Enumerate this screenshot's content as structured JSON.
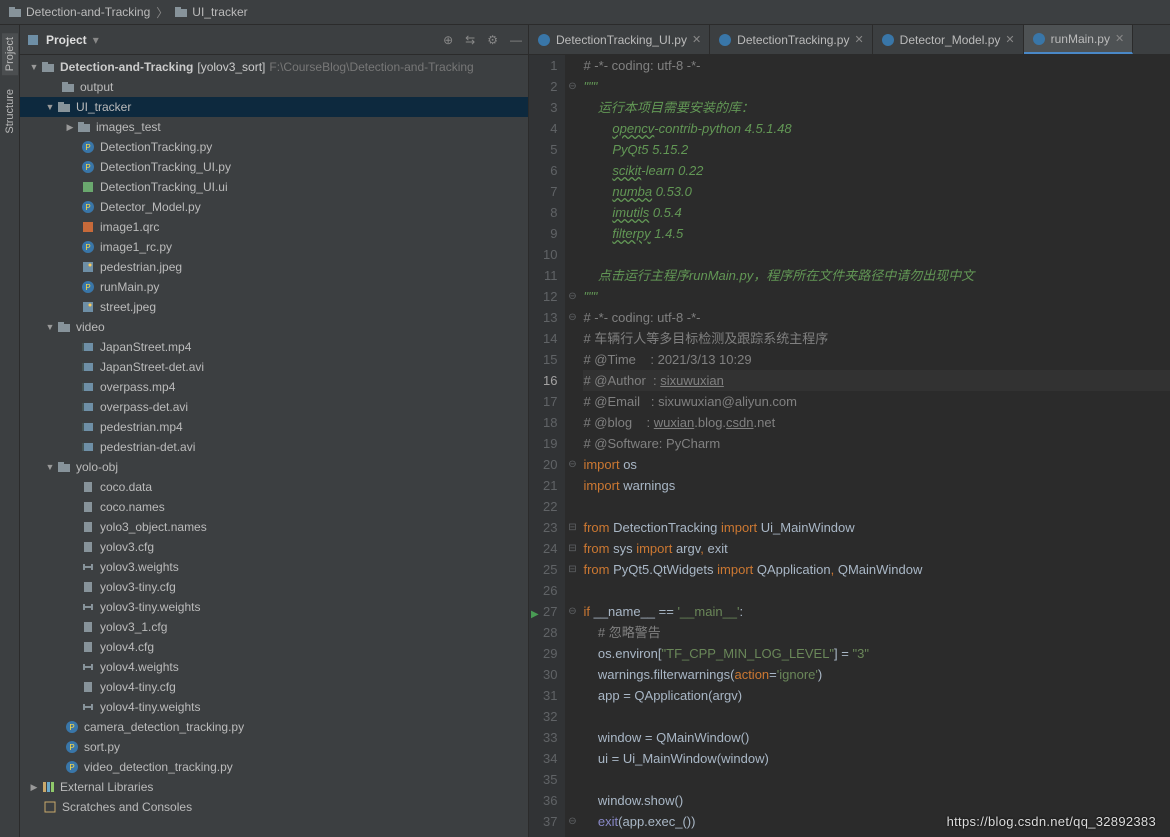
{
  "breadcrumb": {
    "root": "Detection-and-Tracking",
    "current": "UI_tracker"
  },
  "toolwindow": {
    "title": "Project"
  },
  "sideTabs": {
    "project": "Project",
    "structure": "Structure"
  },
  "tree": {
    "root": {
      "name": "Detection-and-Tracking",
      "branch": "[yolov3_sort]",
      "path": "F:\\CourseBlog\\Detection-and-Tracking"
    },
    "output": "output",
    "ui_tracker": "UI_tracker",
    "images_test": "images_test",
    "files_ui": [
      "DetectionTracking.py",
      "DetectionTracking_UI.py",
      "DetectionTracking_UI.ui",
      "Detector_Model.py",
      "image1.qrc",
      "image1_rc.py",
      "pedestrian.jpeg",
      "runMain.py",
      "street.jpeg"
    ],
    "video": "video",
    "files_video": [
      "JapanStreet.mp4",
      "JapanStreet-det.avi",
      "overpass.mp4",
      "overpass-det.avi",
      "pedestrian.mp4",
      "pedestrian-det.avi"
    ],
    "yolo": "yolo-obj",
    "files_yolo": [
      "coco.data",
      "coco.names",
      "yolo3_object.names",
      "yolov3.cfg",
      "yolov3.weights",
      "yolov3-tiny.cfg",
      "yolov3-tiny.weights",
      "yolov3_1.cfg",
      "yolov4.cfg",
      "yolov4.weights",
      "yolov4-tiny.cfg",
      "yolov4-tiny.weights"
    ],
    "root_files": [
      "camera_detection_tracking.py",
      "sort.py",
      "video_detection_tracking.py"
    ],
    "external": "External Libraries",
    "scratches": "Scratches and Consoles"
  },
  "tabs": [
    {
      "label": "DetectionTracking_UI.py",
      "active": false
    },
    {
      "label": "DetectionTracking.py",
      "active": false
    },
    {
      "label": "Detector_Model.py",
      "active": false
    },
    {
      "label": "runMain.py",
      "active": true
    }
  ],
  "code": {
    "l1": "# -*- coding: utf-8 -*-",
    "l2": "\"\"\"",
    "l3": "    运行本项目需要安装的库：",
    "l4a": "        ",
    "l4b": "opencv",
    "l4c": "-contrib-python 4.5.1.48",
    "l5": "        PyQt5 5.15.2",
    "l6a": "        ",
    "l6b": "scikit",
    "l6c": "-learn 0.22",
    "l7a": "        ",
    "l7b": "numba",
    "l7c": " 0.53.0",
    "l8a": "        ",
    "l8b": "imutils",
    "l8c": " 0.5.4",
    "l9a": "        ",
    "l9b": "filterpy",
    "l9c": " 1.4.5",
    "l11": "    点击运行主程序runMain.py，程序所在文件夹路径中请勿出现中文",
    "l12": "\"\"\"",
    "l13": "# -*- coding: utf-8 -*-",
    "l14": "# 车辆行人等多目标检测及跟踪系统主程序",
    "l15": "# @Time    : 2021/3/13 10:29",
    "l16a": "# @Author  : ",
    "l16b": "sixuwuxian",
    "l17": "# @Email   : sixuwuxian@aliyun.com",
    "l18a": "# @blog    : ",
    "l18b": "wuxian",
    "l18c": ".blog.",
    "l18d": "csdn",
    "l18e": ".net",
    "l19": "# @Software: PyCharm",
    "l20a": "import",
    "l20b": " os",
    "l21a": "import ",
    "l21b": "warnings",
    "l23a": "from ",
    "l23b": "DetectionTracking ",
    "l23c": "import ",
    "l23d": "Ui_MainWindow",
    "l24a": "from ",
    "l24b": "sys ",
    "l24c": "import ",
    "l24d": "argv",
    "l24e": ", ",
    "l24f": "exit",
    "l25a": "from ",
    "l25b": "PyQt5.QtWidgets ",
    "l25c": "import ",
    "l25d": "QApplication",
    "l25e": ", ",
    "l25f": "QMainWindow",
    "l27a": "if ",
    "l27b": "__name__ == ",
    "l27c": "'__main__'",
    "l27d": ":",
    "l28": "    # 忽略警告",
    "l29a": "    os.environ[",
    "l29b": "\"TF_CPP_MIN_LOG_LEVEL\"",
    "l29c": "] = ",
    "l29d": "\"3\"",
    "l30a": "    warnings.filterwarnings(",
    "l30b": "action",
    "l30c": "=",
    "l30d": "'ignore'",
    "l30e": ")",
    "l31": "    app = QApplication(argv)",
    "l33": "    window = QMainWindow()",
    "l34": "    ui = Ui_MainWindow(window)",
    "l36": "    window.show()",
    "l37a": "    ",
    "l37b": "exit",
    "l37c": "(app.exec_())"
  },
  "watermark": "https://blog.csdn.net/qq_32892383"
}
